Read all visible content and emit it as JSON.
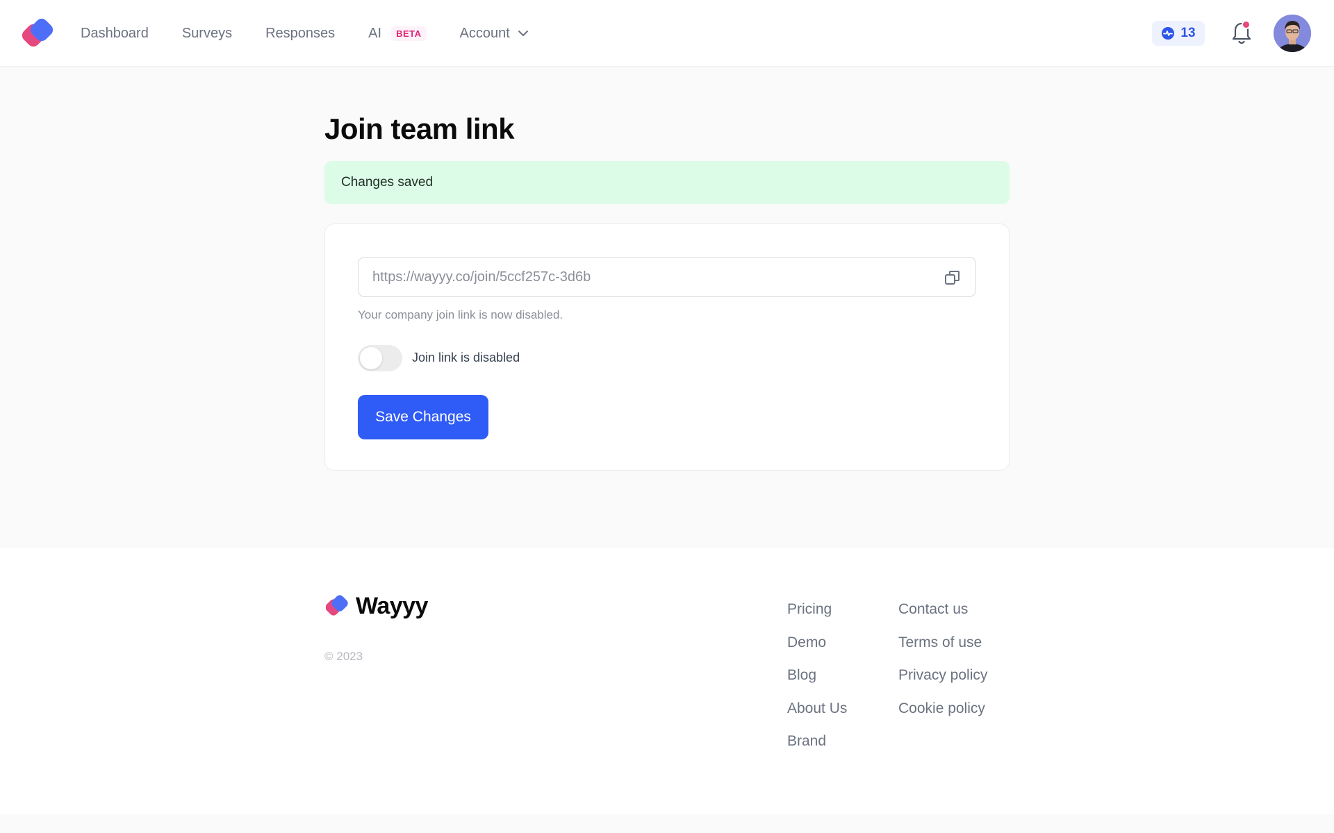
{
  "brand": {
    "name": "Wayyy",
    "colors": {
      "blue": "#4f6ef7",
      "pink": "#e5487d",
      "primary": "#2f5bf6"
    }
  },
  "nav": {
    "items": [
      {
        "label": "Dashboard"
      },
      {
        "label": "Surveys"
      },
      {
        "label": "Responses"
      },
      {
        "label": "AI",
        "badge": "BETA"
      },
      {
        "label": "Account",
        "icon": "chevron-down-icon"
      }
    ],
    "credits": "13",
    "notifications_icon": "bell-icon"
  },
  "page": {
    "title": "Join team link",
    "alert": "Changes saved",
    "join_link": "https://wayyy.co/join/5ccf257c-3d6b",
    "helper_text": "Your company join link is now disabled.",
    "toggle": {
      "label": "Join link is disabled",
      "enabled": false
    },
    "save_button": "Save Changes"
  },
  "footer": {
    "brand": "Wayyy",
    "copyright": "© 2023",
    "col1": [
      "Pricing",
      "Demo",
      "Blog",
      "About Us",
      "Brand"
    ],
    "col2": [
      "Contact us",
      "Terms of use",
      "Privacy policy",
      "Cookie policy"
    ]
  }
}
